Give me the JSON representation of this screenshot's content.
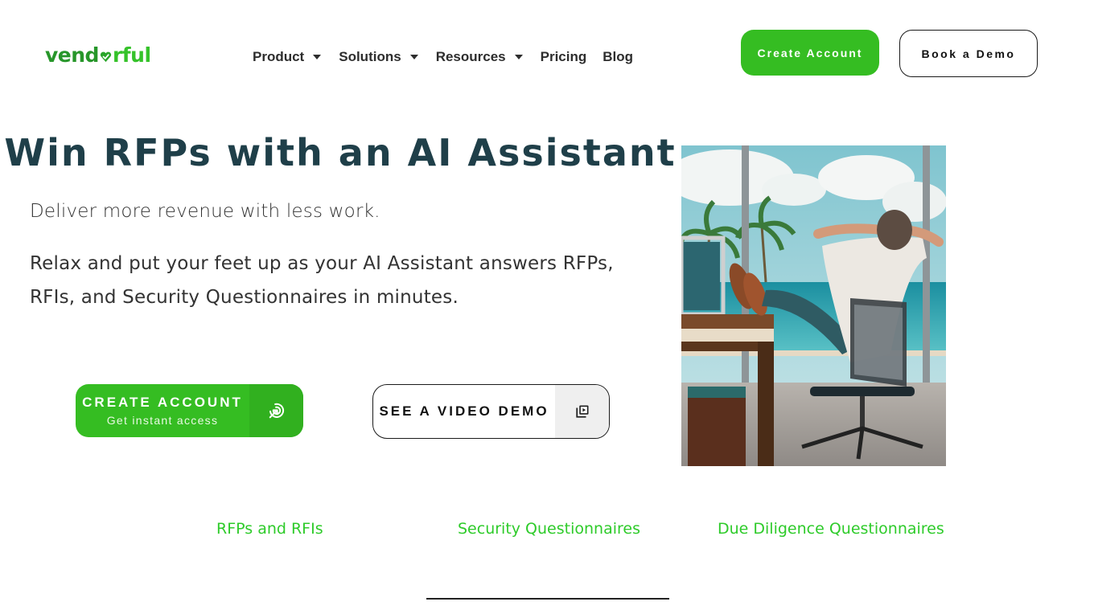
{
  "brand": {
    "logo_part1": "vend",
    "logo_part2": "rful",
    "logo_heart_icon": "heart-check-icon",
    "primary_color": "#35bd22",
    "heading_color": "#1f3f49",
    "tab_color": "#2ecb2a"
  },
  "nav": {
    "items": [
      {
        "label": "Product",
        "has_dropdown": true
      },
      {
        "label": "Solutions",
        "has_dropdown": true
      },
      {
        "label": "Resources",
        "has_dropdown": true
      },
      {
        "label": "Pricing",
        "has_dropdown": false
      },
      {
        "label": "Blog",
        "has_dropdown": false
      }
    ],
    "create_account_label": "Create Account",
    "book_demo_label": "Book a Demo"
  },
  "hero": {
    "title": "Win RFPs with an AI Assistant",
    "subtitle": "Deliver more revenue with less work.",
    "body": "Relax and put your feet up as your AI Assistant answers RFPs, RFIs, and Security Questionnaires in minutes.",
    "cta_create": {
      "title": "CREATE ACCOUNT",
      "subtitle": "Get instant access",
      "icon": "target-click-icon"
    },
    "cta_video": {
      "label": "SEE A VIDEO DEMO",
      "icon": "video-library-icon"
    },
    "image_alt": "Man relaxing with feet on desk facing a beach view"
  },
  "tabs": {
    "items": [
      {
        "label": "RFPs and RFIs",
        "active": false
      },
      {
        "label": "Security Questionnaires",
        "active": true
      },
      {
        "label": "Due Diligence Questionnaires",
        "active": false
      }
    ]
  }
}
